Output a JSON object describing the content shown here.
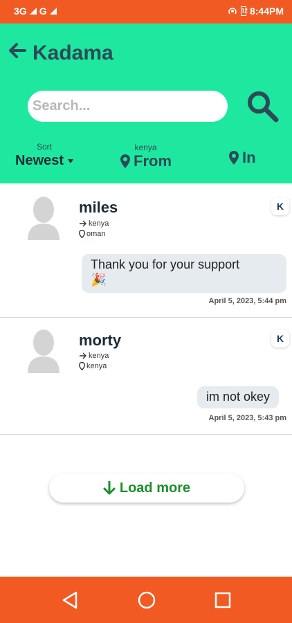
{
  "status_bar": {
    "network_left": "3G",
    "network_right": "G",
    "battery": "12",
    "time": "8:44PM"
  },
  "header": {
    "title": "Kadama",
    "search_placeholder": "Search...",
    "sort_label": "Sort",
    "sort_value": "Newest",
    "from_label": "kenya",
    "from_value": "From",
    "in_value": "In"
  },
  "messages": [
    {
      "name": "miles",
      "to": "kenya",
      "location": "oman",
      "badge": "K",
      "text": "Thank you for your support",
      "emoji": "🎉",
      "timestamp": "April 5, 2023, 5:44 pm"
    },
    {
      "name": "morty",
      "to": "kenya",
      "location": "kenya",
      "badge": "K",
      "text": "im not okey",
      "timestamp": "April 5, 2023, 5:43 pm"
    }
  ],
  "load_more_label": "Load more",
  "colors": {
    "status_bar": "#f15a22",
    "header": "#1ee8a0",
    "title": "#2d4a56",
    "load_more": "#1a8f2a"
  }
}
